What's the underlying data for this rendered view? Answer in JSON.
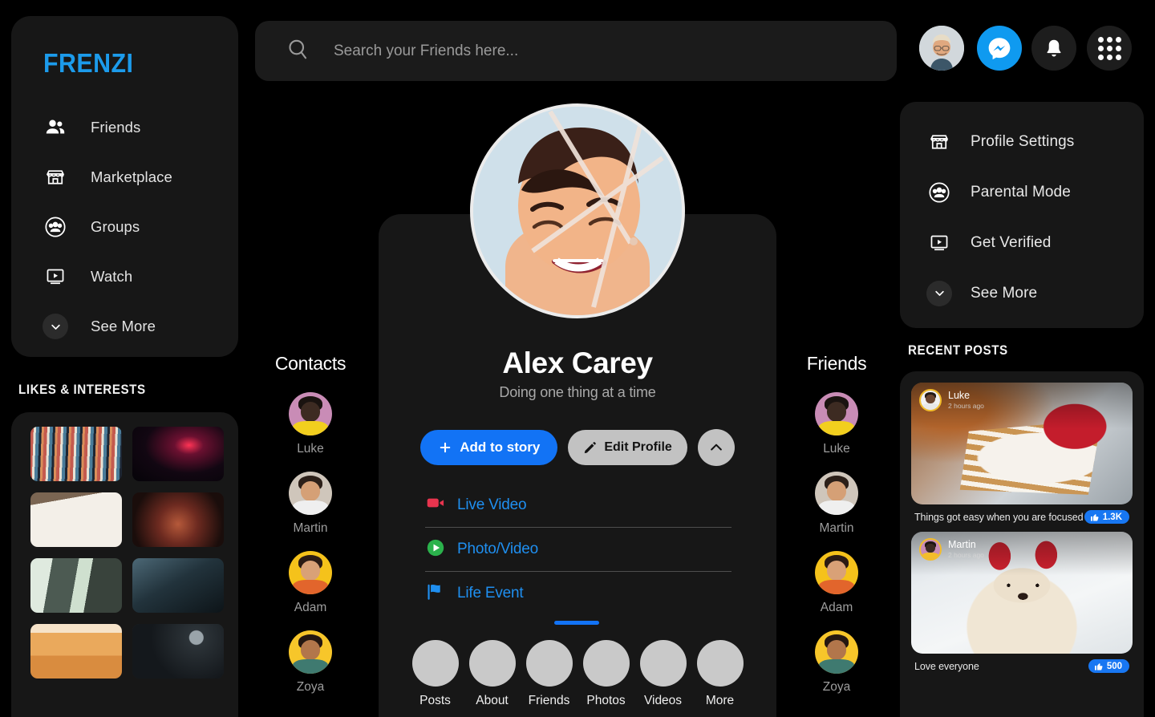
{
  "brand": {
    "name": "FRENZI",
    "color": "#1c9beb"
  },
  "search": {
    "placeholder": "Search your Friends here...",
    "value": "",
    "icon": "search-icon"
  },
  "topbar": {
    "avatar_icon": "user-avatar",
    "messenger_icon": "messenger-icon",
    "notifications_icon": "bell-icon",
    "apps_icon": "grid-menu-icon"
  },
  "sidebar": {
    "items": [
      {
        "label": "Friends",
        "icon": "friends-icon"
      },
      {
        "label": "Marketplace",
        "icon": "marketplace-icon"
      },
      {
        "label": "Groups",
        "icon": "groups-icon"
      },
      {
        "label": "Watch",
        "icon": "watch-icon"
      },
      {
        "label": "See More",
        "icon": "chevron-down-icon"
      }
    ],
    "likes_title": "LIKES & INTERESTS",
    "tiles": [
      {
        "name": "textile-threads"
      },
      {
        "name": "concert-stage"
      },
      {
        "name": "art-tools"
      },
      {
        "name": "festival-crowd"
      },
      {
        "name": "gym-treadmills"
      },
      {
        "name": "weightlifting"
      },
      {
        "name": "desert-dunes"
      },
      {
        "name": "dj-mixer"
      }
    ]
  },
  "right_menu": {
    "items": [
      {
        "label": "Profile Settings",
        "icon": "marketplace-icon"
      },
      {
        "label": "Parental Mode",
        "icon": "groups-icon"
      },
      {
        "label": "Get Verified",
        "icon": "watch-icon"
      },
      {
        "label": "See More",
        "icon": "chevron-down-icon"
      }
    ]
  },
  "recent_posts": {
    "title": "RECENT POSTS",
    "posts": [
      {
        "author": "Luke",
        "timestamp": "2 hours ago",
        "caption": "Things got easy when you are focused",
        "likes": "1.3K",
        "image": "cake-slice-photo"
      },
      {
        "author": "Martin",
        "timestamp": "2 hours ago",
        "caption": "Love everyone",
        "likes": "500",
        "image": "dog-in-snow-photo"
      }
    ]
  },
  "profile": {
    "photo_alt": "alex-carey-portrait",
    "name": "Alex Carey",
    "tagline": "Doing one thing at a time",
    "add_story_label": "Add to story",
    "edit_profile_label": "Edit Profile",
    "collapse_icon": "chevron-up-icon",
    "composer": [
      {
        "label": "Live Video",
        "icon": "video-camera-icon",
        "color": "#e8344e"
      },
      {
        "label": "Photo/Video",
        "icon": "play-circle-icon",
        "color": "#2bb24c"
      },
      {
        "label": "Life Event",
        "icon": "flag-icon",
        "color": "#1f8ff0"
      }
    ],
    "tabs": [
      {
        "label": "Posts",
        "active": true
      },
      {
        "label": "About",
        "active": false
      },
      {
        "label": "Friends",
        "active": false
      },
      {
        "label": "Photos",
        "active": false
      },
      {
        "label": "Videos",
        "active": false
      },
      {
        "label": "More",
        "active": false
      }
    ]
  },
  "contacts": {
    "title": "Contacts",
    "people": [
      {
        "name": "Luke",
        "bg": "#c98cb6"
      },
      {
        "name": "Martin",
        "bg": "#cfc6bb"
      },
      {
        "name": "Adam",
        "bg": "#f5c21b"
      },
      {
        "name": "Zoya",
        "bg": "#f7c62a"
      }
    ]
  },
  "friends": {
    "title": "Friends",
    "people": [
      {
        "name": "Luke",
        "bg": "#c98cb6"
      },
      {
        "name": "Martin",
        "bg": "#cfc6bb"
      },
      {
        "name": "Adam",
        "bg": "#f5c21b"
      },
      {
        "name": "Zoya",
        "bg": "#f7c62a"
      }
    ]
  }
}
